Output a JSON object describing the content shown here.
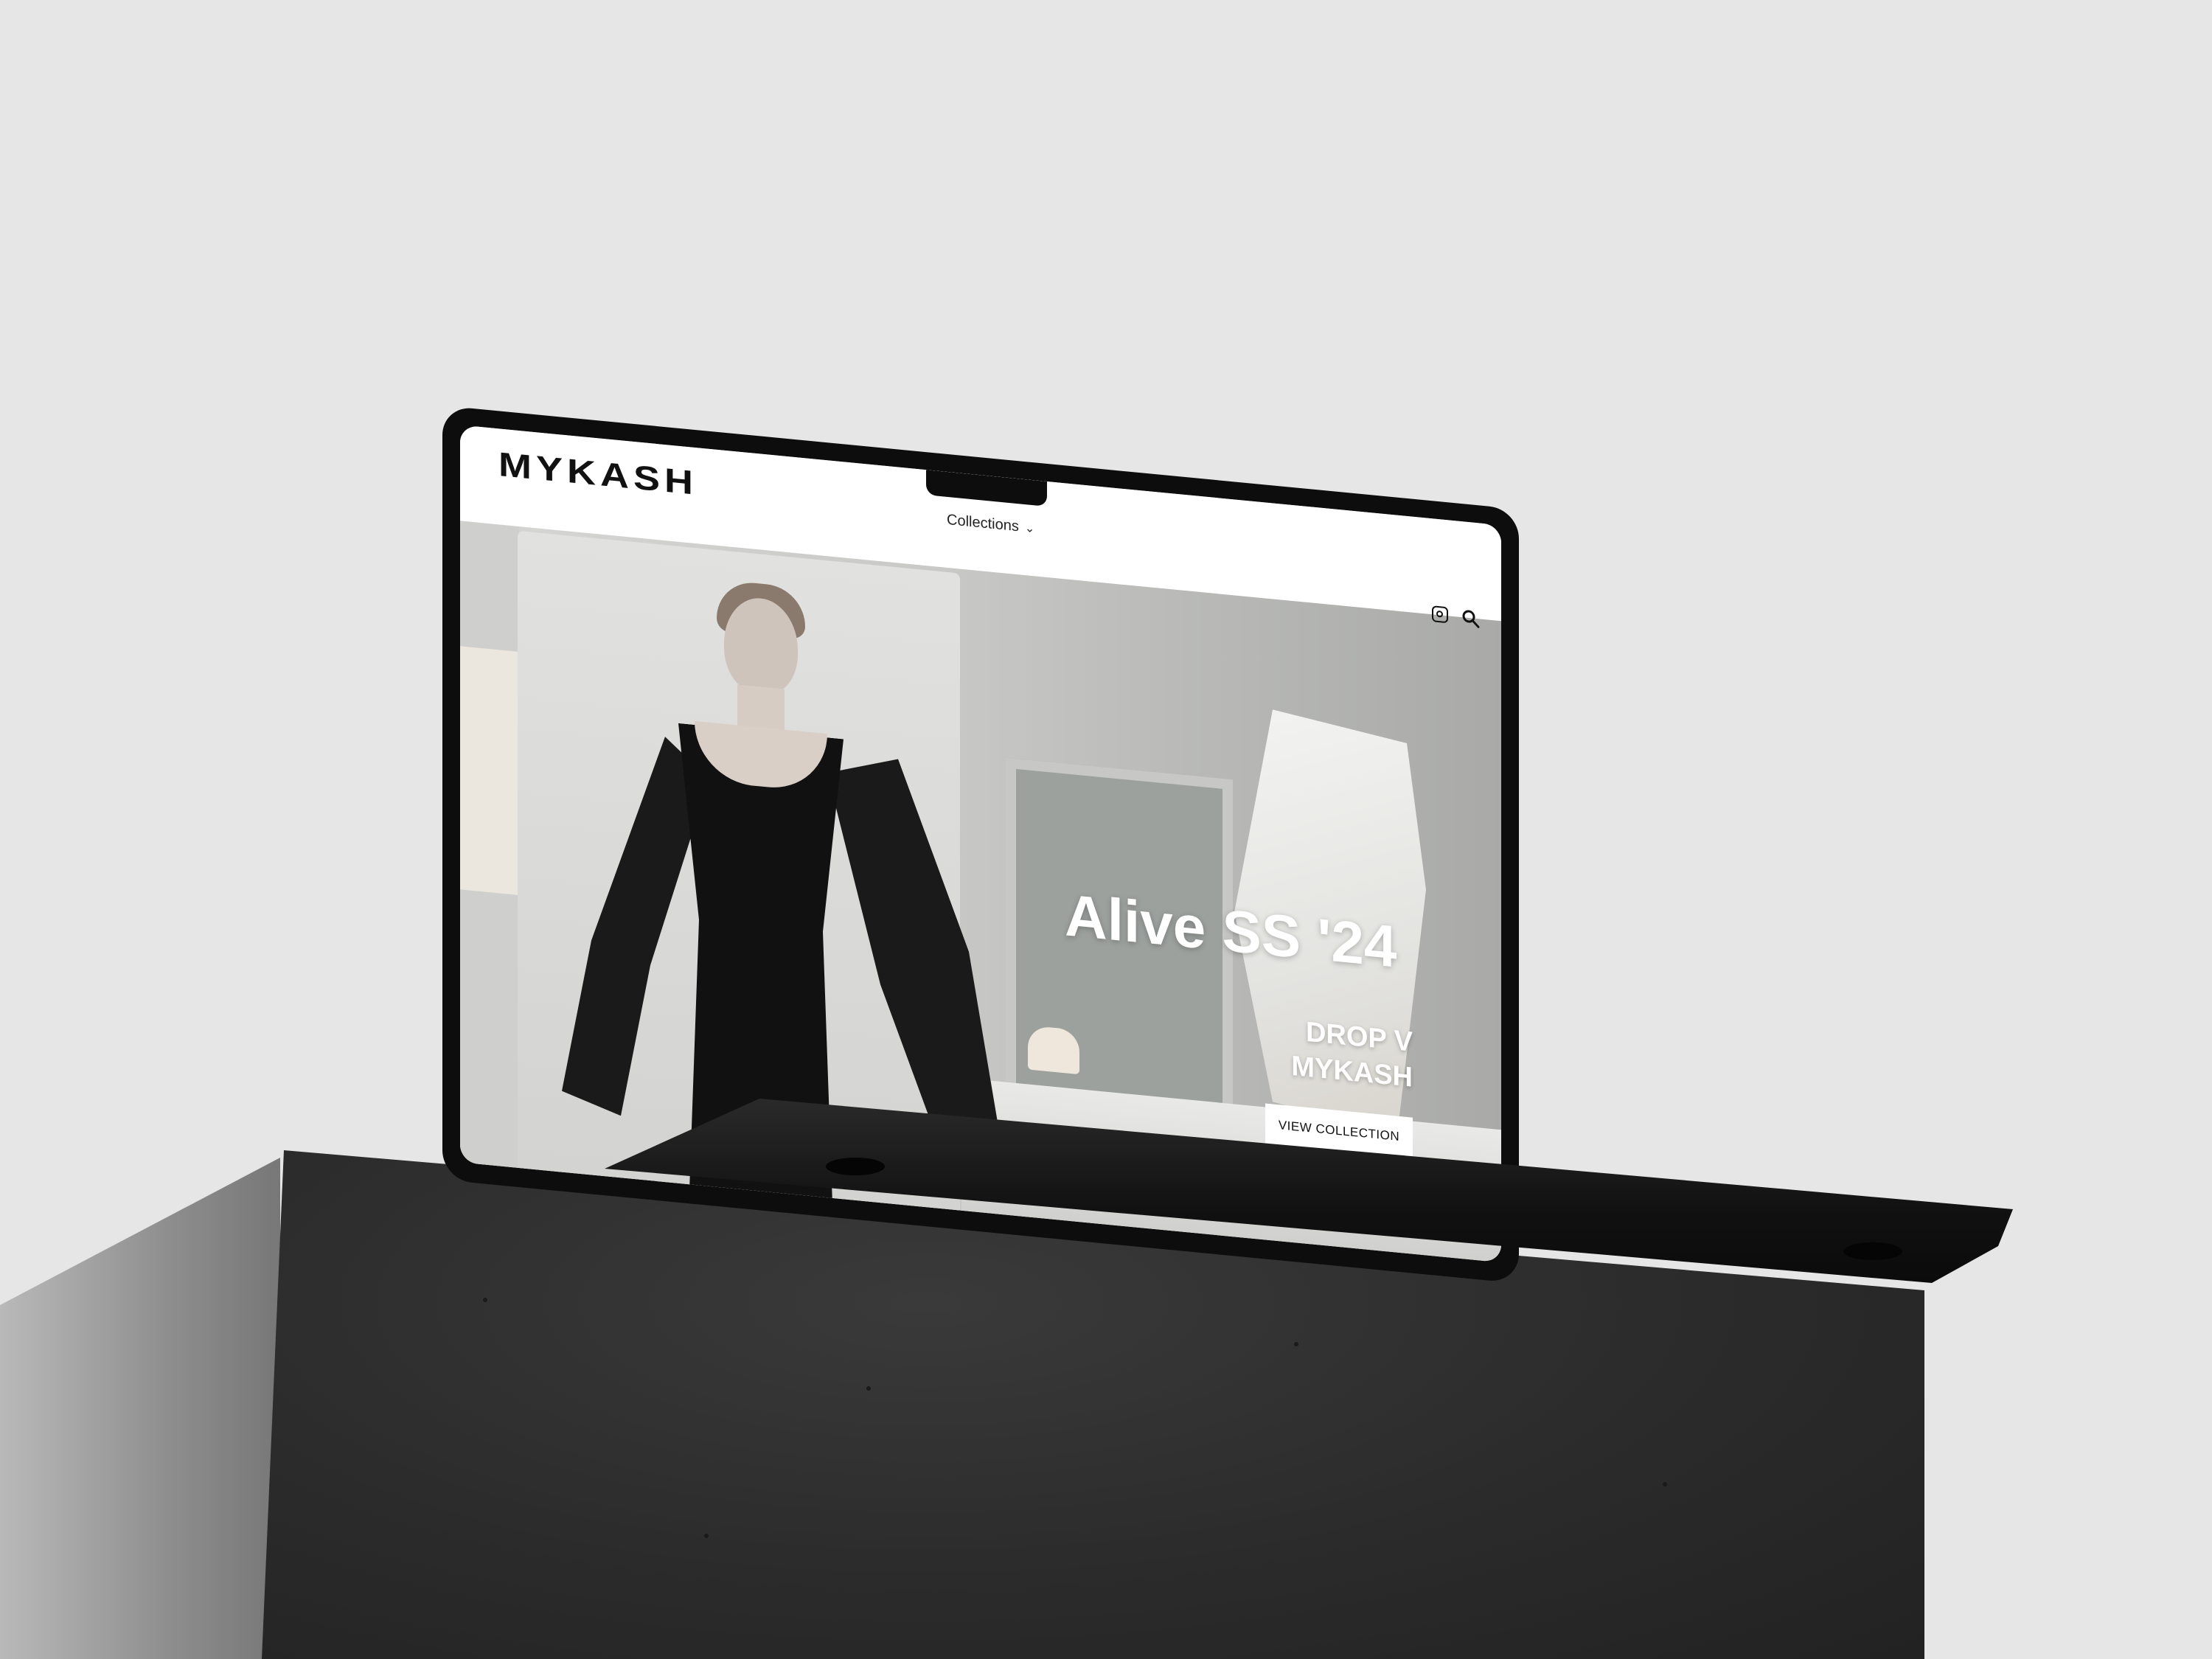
{
  "header": {
    "logo": "MYKASH",
    "nav": {
      "collections_label": "Collections",
      "chevron": "⌄"
    },
    "icons": [
      "instagram-icon",
      "search-icon"
    ]
  },
  "hero": {
    "title": "Alive SS '24",
    "subtitle_line1": "DROP V",
    "subtitle_line2": "MYKASH",
    "cta_label": "VIEW COLLECTION"
  },
  "colors": {
    "background": "#e6e6e6",
    "pedestal": "#2b2b2b",
    "laptop": "#0d0d0d",
    "cta_bg": "#ffffff",
    "cta_text": "#111111"
  }
}
